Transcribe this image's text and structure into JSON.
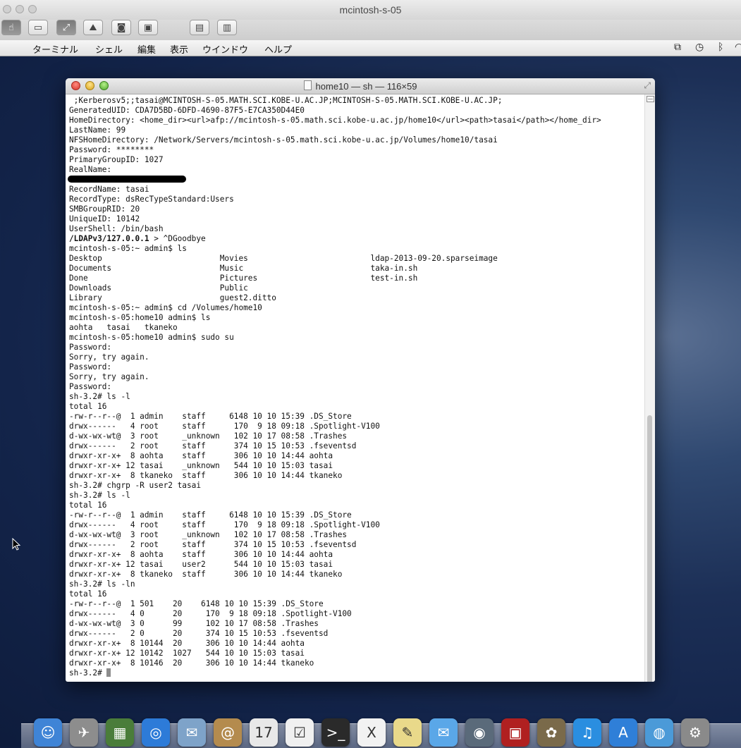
{
  "viewer": {
    "title": "mcintosh-s-05"
  },
  "menubar": {
    "apple_icon": "apple-icon",
    "items": [
      "ターミナル",
      "シェル",
      "編集",
      "表示",
      "ウインドウ",
      "ヘルプ"
    ]
  },
  "terminal": {
    "title": "home10 — sh — 116×59",
    "lines": [
      " ;Kerberosv5;;tasai@MCINTOSH-S-05.MATH.SCI.KOBE-U.AC.JP;MCINTOSH-S-05.MATH.SCI.KOBE-U.AC.JP;",
      "GeneratedUID: CDA7D5BD-6DFD-4690-87F5-E7CA350D44E0",
      "HomeDirectory: <home_dir><url>afp://mcintosh-s-05.math.sci.kobe-u.ac.jp/home10</url><path>tasai</path></home_dir>",
      "LastName: 99",
      "NFSHomeDirectory: /Network/Servers/mcintosh-s-05.math.sci.kobe-u.ac.jp/Volumes/home10/tasai",
      "Password: ********",
      "PrimaryGroupID: 1027",
      "RealName:",
      "__REDACTED__",
      "RecordName: tasai",
      "RecordType: dsRecTypeStandard:Users",
      "SMBGroupRID: 20",
      "UniqueID: 10142",
      "UserShell: /bin/bash",
      "__BOLD__/LDAPv3/127.0.0.1 > ^DGoodbye",
      "mcintosh-s-05:~ admin$ ls",
      "Desktop                         Movies                          ldap-2013-09-20.sparseimage",
      "Documents                       Music                           taka-in.sh",
      "Done                            Pictures                        test-in.sh",
      "Downloads                       Public",
      "Library                         guest2.ditto",
      "mcintosh-s-05:~ admin$ cd /Volumes/home10",
      "mcintosh-s-05:home10 admin$ ls",
      "aohta   tasai   tkaneko",
      "mcintosh-s-05:home10 admin$ sudo su",
      "Password:",
      "Sorry, try again.",
      "Password:",
      "Sorry, try again.",
      "Password:",
      "sh-3.2# ls -l",
      "total 16",
      "-rw-r--r--@  1 admin    staff     6148 10 10 15:39 .DS_Store",
      "drwx------   4 root     staff      170  9 18 09:18 .Spotlight-V100",
      "d-wx-wx-wt@  3 root     _unknown   102 10 17 08:58 .Trashes",
      "drwx------   2 root     staff      374 10 15 10:53 .fseventsd",
      "drwxr-xr-x+  8 aohta    staff      306 10 10 14:44 aohta",
      "drwxr-xr-x+ 12 tasai    _unknown   544 10 10 15:03 tasai",
      "drwxr-xr-x+  8 tkaneko  staff      306 10 10 14:44 tkaneko",
      "sh-3.2# chgrp -R user2 tasai",
      "sh-3.2# ls -l",
      "total 16",
      "-rw-r--r--@  1 admin    staff     6148 10 10 15:39 .DS_Store",
      "drwx------   4 root     staff      170  9 18 09:18 .Spotlight-V100",
      "d-wx-wx-wt@  3 root     _unknown   102 10 17 08:58 .Trashes",
      "drwx------   2 root     staff      374 10 15 10:53 .fseventsd",
      "drwxr-xr-x+  8 aohta    staff      306 10 10 14:44 aohta",
      "drwxr-xr-x+ 12 tasai    user2      544 10 10 15:03 tasai",
      "drwxr-xr-x+  8 tkaneko  staff      306 10 10 14:44 tkaneko",
      "sh-3.2# ls -ln",
      "total 16",
      "-rw-r--r--@  1 501    20    6148 10 10 15:39 .DS_Store",
      "drwx------   4 0      20     170  9 18 09:18 .Spotlight-V100",
      "d-wx-wx-wt@  3 0      99     102 10 17 08:58 .Trashes",
      "drwx------   2 0      20     374 10 15 10:53 .fseventsd",
      "drwxr-xr-x+  8 10144  20     306 10 10 14:44 aohta",
      "drwxr-xr-x+ 12 10142  1027   544 10 10 15:03 tasai",
      "drwxr-xr-x+  8 10146  20     306 10 10 14:44 tkaneko",
      "__PROMPT__sh-3.2# "
    ]
  },
  "dock": {
    "icons": [
      {
        "name": "finder-icon",
        "glyph": "☺",
        "color": "#3f84d6"
      },
      {
        "name": "launchpad-icon",
        "glyph": "✈",
        "color": "#8d8d8d"
      },
      {
        "name": "mission-control-icon",
        "glyph": "▦",
        "color": "#4a7d3a"
      },
      {
        "name": "safari-icon",
        "glyph": "◎",
        "color": "#2d7bd8"
      },
      {
        "name": "mail-icon",
        "glyph": "✉",
        "color": "#7ea3c9"
      },
      {
        "name": "contacts-icon",
        "glyph": "@",
        "color": "#b48b4e"
      },
      {
        "name": "calendar-icon",
        "glyph": "17",
        "color": "#e8e8e8"
      },
      {
        "name": "reminders-icon",
        "glyph": "☑",
        "color": "#f0f0f0"
      },
      {
        "name": "terminal-icon",
        "glyph": ">_",
        "color": "#2a2a2a"
      },
      {
        "name": "x11-icon",
        "glyph": "X",
        "color": "#f2f2f2"
      },
      {
        "name": "stickies-icon",
        "glyph": "✎",
        "color": "#e9d98a"
      },
      {
        "name": "messages-icon",
        "glyph": "✉",
        "color": "#5aa7e8"
      },
      {
        "name": "facetime-icon",
        "glyph": "◉",
        "color": "#5a6a7a"
      },
      {
        "name": "photo-booth-icon",
        "glyph": "▣",
        "color": "#b02020"
      },
      {
        "name": "iphoto-icon",
        "glyph": "✿",
        "color": "#7a6a4a"
      },
      {
        "name": "itunes-icon",
        "glyph": "♫",
        "color": "#2a8ee0"
      },
      {
        "name": "app-store-icon",
        "glyph": "A",
        "color": "#2f7fd8"
      },
      {
        "name": "network-globe-icon",
        "glyph": "◍",
        "color": "#4b9ad8"
      },
      {
        "name": "system-preferences-icon",
        "glyph": "⚙",
        "color": "#8a8a8a"
      }
    ]
  }
}
